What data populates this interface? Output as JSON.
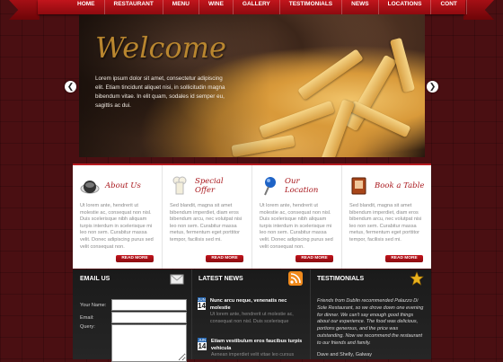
{
  "nav": {
    "items": [
      "HOME",
      "RESTAURANT",
      "MENU",
      "WINE",
      "GALLERY",
      "TESTIMONIALS",
      "NEWS",
      "LOCATIONS",
      "CONT"
    ]
  },
  "slider": {
    "title": "Welcome",
    "text": "Lorem ipsum dolor sit amet, consectetur adipiscing elit. Etiam tincidunt aliquet nisi, in sollicitudin magna bibendum vitae. In elit quam, sodales id semper eu, sagittis ac dui.",
    "prev_icon": "chevron-left-icon",
    "next_icon": "chevron-right-icon"
  },
  "features": [
    {
      "title": "About Us",
      "icon": "plate-icon",
      "text": "Ut lorem ante, hendrerit ut molestie ac, consequat non nisl. Duis scelerisque nibh aliquam turpis interdum in scelerisque mi leo non sem. Curabitur massa velit. Donec adipiscing purus sed velit consequat non.",
      "button": "READ MORE"
    },
    {
      "title": "Special Offer",
      "icon": "chef-icon",
      "text": "Sed blandit, magna sit amet bibendum imperdiet, diam eros bibendum arcu, nec volutpat nisi leo non sem. Curabitur massa metus, fermentum eget porttitor tempor, facilisis sed mi.",
      "button": "READ MORE"
    },
    {
      "title": "Our Location",
      "icon": "map-pin-icon",
      "text": "Ut lorem ante, hendrerit ut molestie ac, consequat non nisl. Duis scelerisque nibh aliquam turpis interdum in scelerisque mi leo non sem. Curabitur massa velit. Donec adipiscing purus sed velit consequat non.",
      "button": "READ MORE"
    },
    {
      "title": "Book a Table",
      "icon": "book-icon",
      "text": "Sed blandit, magna sit amet bibendum imperdiet, diam eros bibendum arcu, nec volutpat nisi leo non sem. Curabitur massa metus, fermentum eget porttitor tempor, facilisis sed mi.",
      "button": "READ MORE"
    }
  ],
  "footer": {
    "email": {
      "heading": "EMAIL US",
      "icon": "envelope-icon",
      "name_label": "Your Name:",
      "email_label": "Email:",
      "query_label": "Query:",
      "name_value": "",
      "email_value": "",
      "query_value": ""
    },
    "news": {
      "heading": "LATEST NEWS",
      "icon": "rss-icon",
      "items": [
        {
          "month": "JUN",
          "day": "14",
          "title": "Nunc arcu neque, venenatis nec molestie",
          "text": "Ut lorem ante, hendrerit ut molestie ac, consequat non nisl. Duis scelerisque"
        },
        {
          "month": "JUN",
          "day": "14",
          "title": "Etiam vestibulum eros faucibus turpis vehicula",
          "text": "Aenean imperdiet velit vitae leo cursus"
        }
      ]
    },
    "testimonials": {
      "heading": "TESTIMONIALS",
      "icon": "star-icon",
      "quote": "Friends from Dublin recommended Palazzo Di Sole Restaurant, so we drove down one evening for dinner. We can't say enough good things about our experience. The food was delicious, portions generous, and the price was outstanding. Now we recommend the restaurant to our friends and family.",
      "author": "Dave and Shelly, Galway"
    }
  },
  "colors": {
    "brand_red": "#b71a20",
    "background": "#4a0f12",
    "title_gold": "#b9862f"
  }
}
